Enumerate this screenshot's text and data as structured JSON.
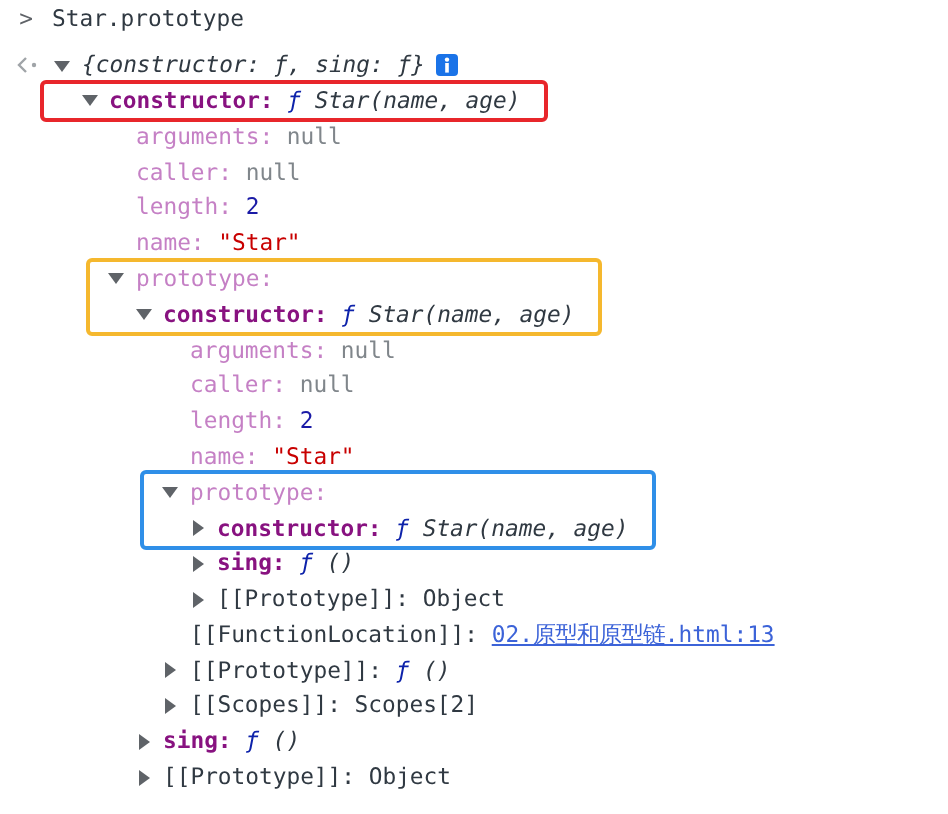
{
  "console": [
    {
      "kind": "input",
      "prompt": ">",
      "text": "Star.prototype"
    },
    {
      "kind": "result",
      "summary": "{constructor: ƒ, sing: ƒ}",
      "expanded": true,
      "children": [
        {
          "key": "constructor:",
          "enumerable": true,
          "internal": false,
          "kind": "function",
          "marker": "ƒ",
          "value": "Star(name, age)",
          "expanded": true,
          "highlight": {
            "color": "#e8262b",
            "kind": "row"
          },
          "children": [
            {
              "key": "arguments:",
              "enumerable": false,
              "internal": false,
              "kind": "null",
              "value": "null"
            },
            {
              "key": "caller:",
              "enumerable": false,
              "internal": false,
              "kind": "null",
              "value": "null"
            },
            {
              "key": "length:",
              "enumerable": false,
              "internal": false,
              "kind": "number",
              "value": "2"
            },
            {
              "key": "name:",
              "enumerable": false,
              "internal": false,
              "kind": "string",
              "value": "\"Star\""
            },
            {
              "key": "prototype:",
              "enumerable": false,
              "internal": false,
              "expanded": true,
              "highlight": {
                "color": "#f5b82e",
                "kind": "with_first_child"
              },
              "children": [
                {
                  "key": "constructor:",
                  "enumerable": true,
                  "internal": false,
                  "kind": "function",
                  "marker": "ƒ",
                  "value": "Star(name, age)",
                  "expanded": true,
                  "children": [
                    {
                      "key": "arguments:",
                      "enumerable": false,
                      "internal": false,
                      "kind": "null",
                      "value": "null"
                    },
                    {
                      "key": "caller:",
                      "enumerable": false,
                      "internal": false,
                      "kind": "null",
                      "value": "null"
                    },
                    {
                      "key": "length:",
                      "enumerable": false,
                      "internal": false,
                      "kind": "number",
                      "value": "2"
                    },
                    {
                      "key": "name:",
                      "enumerable": false,
                      "internal": false,
                      "kind": "string",
                      "value": "\"Star\""
                    },
                    {
                      "key": "prototype:",
                      "enumerable": false,
                      "internal": false,
                      "expanded": true,
                      "highlight": {
                        "color": "#2f8fe8",
                        "kind": "with_first_child"
                      },
                      "children": [
                        {
                          "key": "constructor:",
                          "enumerable": true,
                          "internal": false,
                          "kind": "function",
                          "marker": "ƒ",
                          "value": "Star(name, age)",
                          "expanded": false
                        },
                        {
                          "key": "sing:",
                          "enumerable": true,
                          "internal": false,
                          "kind": "function",
                          "marker": "ƒ",
                          "value": "()",
                          "expanded": false
                        },
                        {
                          "key": "[[Prototype]]:",
                          "enumerable": false,
                          "internal": true,
                          "kind": "object",
                          "value": "Object",
                          "expanded": false
                        }
                      ]
                    },
                    {
                      "key": "[[FunctionLocation]]:",
                      "enumerable": false,
                      "internal": true,
                      "kind": "link",
                      "value": "02.原型和原型链.html:13"
                    },
                    {
                      "key": "[[Prototype]]:",
                      "enumerable": false,
                      "internal": true,
                      "kind": "function",
                      "marker": "ƒ",
                      "value": "()",
                      "expanded": false
                    },
                    {
                      "key": "[[Scopes]]:",
                      "enumerable": false,
                      "internal": true,
                      "kind": "object",
                      "value": "Scopes[2]",
                      "expanded": false
                    }
                  ]
                },
                {
                  "key": "sing:",
                  "enumerable": true,
                  "internal": false,
                  "kind": "function",
                  "marker": "ƒ",
                  "value": "()",
                  "expanded": false
                },
                {
                  "key": "[[Prototype]]:",
                  "enumerable": false,
                  "internal": true,
                  "kind": "object",
                  "value": "Object",
                  "expanded": false
                }
              ]
            }
          ]
        }
      ]
    }
  ]
}
